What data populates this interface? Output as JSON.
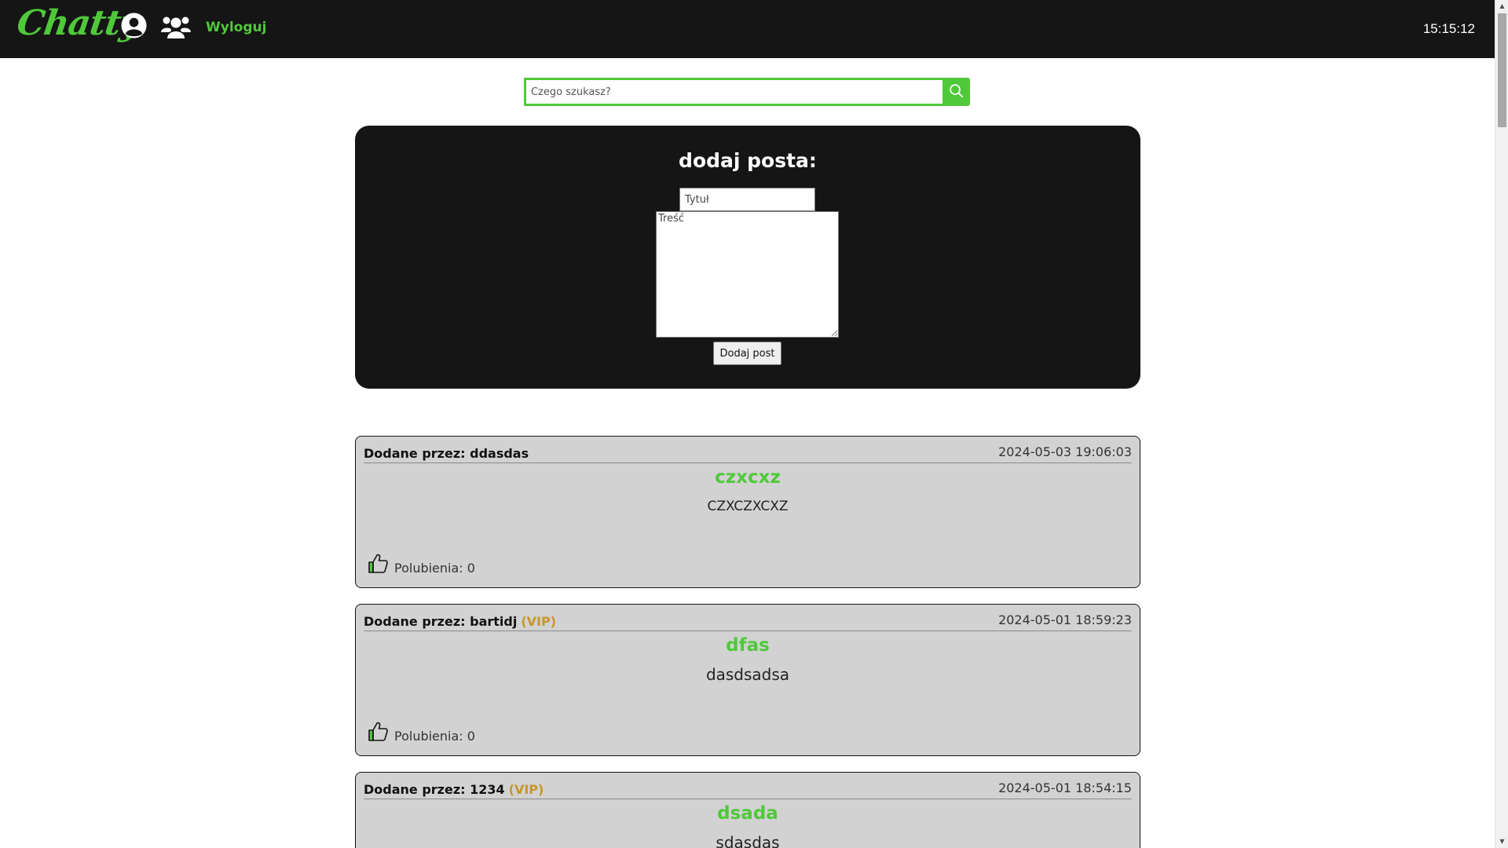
{
  "header": {
    "logo": "Chatty",
    "logout_label": "Wyloguj",
    "clock": "15:15:12"
  },
  "search": {
    "placeholder": "Czego szukasz?"
  },
  "add_post": {
    "heading": "dodaj posta:",
    "title_placeholder": "Tytuł",
    "content_placeholder": "Treść",
    "submit_label": "Dodaj post"
  },
  "colors": {
    "accent": "#4fc93a",
    "header_bg": "#151515",
    "post_bg": "#d2d2d2",
    "vip": "#c7962a"
  },
  "posts": [
    {
      "author_prefix": "Dodane przez: ",
      "author": "ddasdas",
      "vip": "",
      "date": "2024-05-03 19:06:03",
      "title": "czxcxz",
      "body": "CZXCZXCXZ",
      "likes_label": "Polubienia: 0"
    },
    {
      "author_prefix": "Dodane przez: ",
      "author": "bartidj",
      "vip": "(VIP)",
      "date": "2024-05-01 18:59:23",
      "title": "dfas",
      "body": "dasdsadsa",
      "likes_label": "Polubienia: 0"
    },
    {
      "author_prefix": "Dodane przez: ",
      "author": "1234",
      "vip": "(VIP)",
      "date": "2024-05-01 18:54:15",
      "title": "dsada",
      "body": "sdasdas",
      "likes_label": ""
    }
  ]
}
